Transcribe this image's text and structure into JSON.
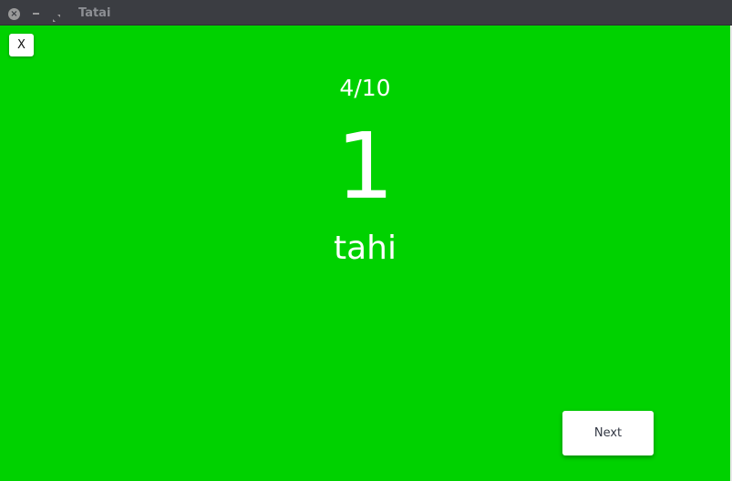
{
  "window": {
    "title": "Tatai",
    "close_glyph": "×",
    "icons": [
      "close-icon",
      "minimize-icon",
      "maximize-icon"
    ]
  },
  "quiz": {
    "close_label": "X",
    "progress": "4/10",
    "number": "1",
    "word": "tahi",
    "next_label": "Next"
  },
  "colors": {
    "background": "#00d200",
    "titlebar": "#3b3d42",
    "text": "#ffffff",
    "button": "#ffffff"
  }
}
